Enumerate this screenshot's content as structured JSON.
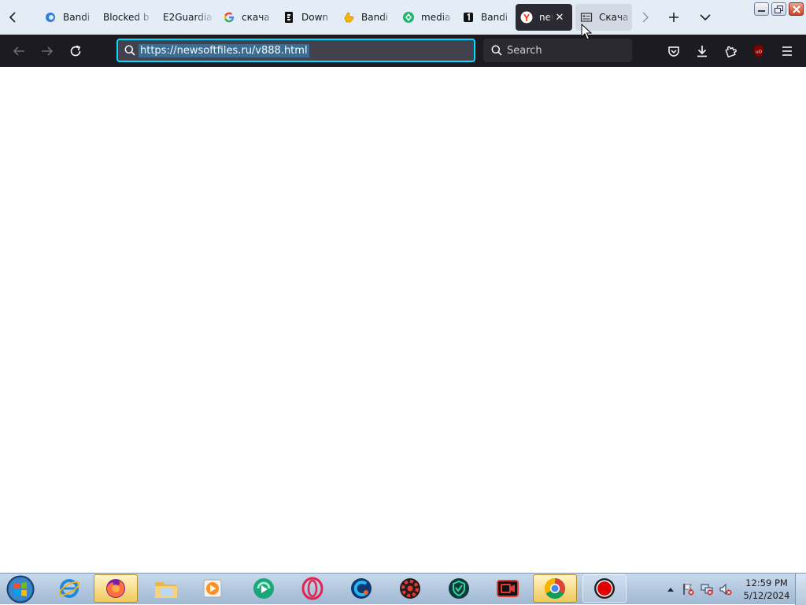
{
  "browser": {
    "tabs": [
      {
        "title": "Bandi",
        "icon": "bandicam-web-icon",
        "state": "normal"
      },
      {
        "title": "Blocked b",
        "icon": "none",
        "state": "normal"
      },
      {
        "title": "E2Guardia",
        "icon": "none",
        "state": "normal"
      },
      {
        "title": "скача",
        "icon": "google-g-icon",
        "state": "normal"
      },
      {
        "title": "Down",
        "icon": "page-e-icon",
        "state": "normal"
      },
      {
        "title": "Bandi",
        "icon": "yellow-hand-icon",
        "state": "normal"
      },
      {
        "title": "media",
        "icon": "green-gem-icon",
        "state": "normal"
      },
      {
        "title": "Bandi",
        "icon": "number-one-icon",
        "state": "normal"
      },
      {
        "title": "new",
        "icon": "yandex-y-icon",
        "state": "active"
      },
      {
        "title": "Скача",
        "icon": "page-layout-icon",
        "state": "hover"
      }
    ],
    "close_tab_glyph": "✕",
    "url": "https://newsoftfiles.ru/v888.html",
    "search_placeholder": "Search",
    "ublock_badge": "uO",
    "colors": {
      "tabstrip": "#e4ecf6",
      "toolbar": "#1c1b22",
      "urlbar_focus": "#00ddff",
      "url_selection": "#3d6c91",
      "active_tab": "#2b2a33"
    }
  },
  "taskbar": {
    "apps": [
      {
        "name": "internet-explorer-icon",
        "state": "normal"
      },
      {
        "name": "firefox-icon",
        "state": "active"
      },
      {
        "name": "file-explorer-icon",
        "state": "normal"
      },
      {
        "name": "media-player-icon",
        "state": "normal"
      },
      {
        "name": "green-play-app-icon",
        "state": "normal"
      },
      {
        "name": "opera-icon",
        "state": "normal"
      },
      {
        "name": "ccleaner-icon",
        "state": "normal"
      },
      {
        "name": "red-gear-app-icon",
        "state": "normal"
      },
      {
        "name": "green-shield-app-icon",
        "state": "normal"
      },
      {
        "name": "screen-recorder-icon",
        "state": "normal"
      },
      {
        "name": "chrome-icon",
        "state": "active"
      },
      {
        "name": "bandicam-record-icon",
        "state": "running"
      }
    ],
    "clock": {
      "time": "12:59 PM",
      "date": "5/12/2024"
    }
  }
}
